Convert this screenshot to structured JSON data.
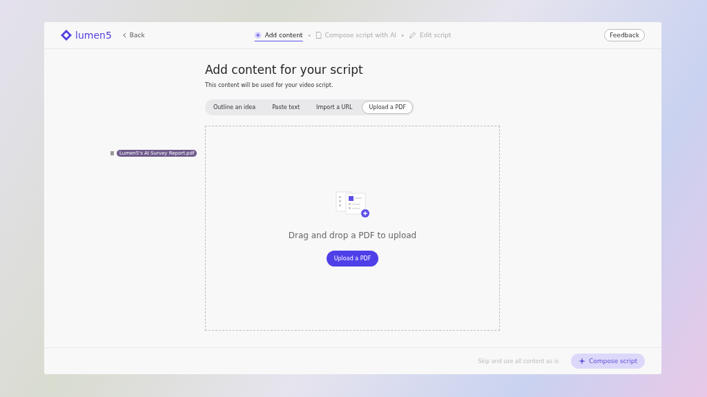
{
  "header": {
    "logo": "lumen5",
    "back": "Back",
    "steps": [
      {
        "label": "Add content",
        "selected": true,
        "kind": "plus"
      },
      {
        "label": "Compose script with AI",
        "selected": false,
        "kind": "doc"
      },
      {
        "label": "Edit script",
        "selected": false,
        "kind": "pen"
      }
    ],
    "feedback": "Feedback"
  },
  "title": "Add content for your script",
  "subtitle": "This content will be used for your video script.",
  "tabs": [
    {
      "label": "Outline an idea",
      "selected": false
    },
    {
      "label": "Paste text",
      "selected": false
    },
    {
      "label": "Import a URL",
      "selected": false
    },
    {
      "label": "Upload a PDF",
      "selected": true
    }
  ],
  "dragged_file": "Lumen5's AI Survey Report.pdf",
  "dropzone": {
    "text": "Drag and drop a PDF to upload",
    "button": "Upload a PDF"
  },
  "footer": {
    "skip": "Skip and use all content as is",
    "compose": {
      "label": "Compose script",
      "disabled": true
    }
  }
}
